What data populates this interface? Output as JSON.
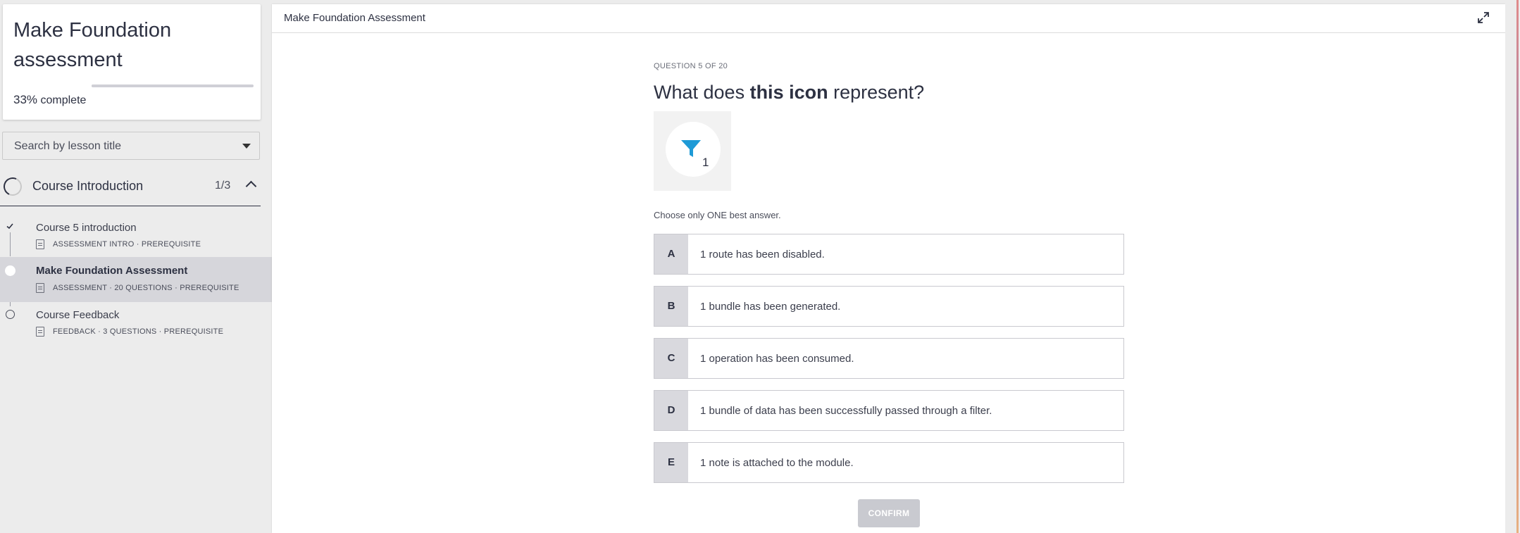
{
  "sidebar": {
    "course_title": "Make Foundation assessment",
    "progress_percent": "33%",
    "progress_suffix": "complete",
    "progress_value": 0.33,
    "search_placeholder": "Search by lesson title",
    "section": {
      "title": "Course Introduction",
      "count": "1/3"
    },
    "lessons": [
      {
        "title": "Course 5 introduction",
        "meta": "ASSESSMENT INTRO · PREREQUISITE",
        "status": "completed"
      },
      {
        "title": "Make Foundation Assessment",
        "meta": "ASSESSMENT · 20 QUESTIONS · PREREQUISITE",
        "status": "current"
      },
      {
        "title": "Course Feedback",
        "meta": "FEEDBACK · 3 QUESTIONS · PREREQUISITE",
        "status": "not-started"
      }
    ]
  },
  "main": {
    "title": "Make Foundation Assessment",
    "question_number": "QUESTION 5 OF 20",
    "question_prefix": "What does ",
    "question_bold": "this icon",
    "question_suffix": " represent?",
    "icon_badge": "1",
    "instruction": "Choose only ONE best answer.",
    "options": [
      {
        "letter": "A",
        "text": "1 route has been disabled."
      },
      {
        "letter": "B",
        "text": "1 bundle has been generated."
      },
      {
        "letter": "C",
        "text": "1 operation has been consumed."
      },
      {
        "letter": "D",
        "text": "1 bundle of data has been successfully passed through a filter."
      },
      {
        "letter": "E",
        "text": "1 note is attached to the module."
      }
    ],
    "confirm_label": "CONFIRM"
  },
  "colors": {
    "accent": "#2d3142",
    "filter_icon": "#1e9ad6",
    "active_lesson_bg": "#d6d6db",
    "confirm_disabled": "#c9cad0"
  }
}
